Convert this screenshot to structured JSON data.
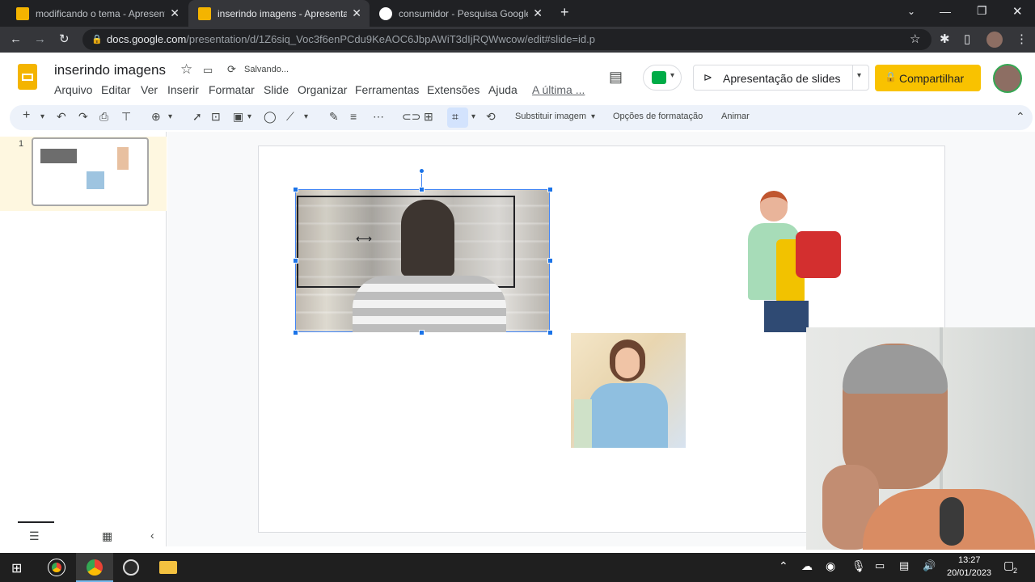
{
  "tabs": [
    {
      "title": "modificando o tema - Apresentação",
      "color": "#f4b400"
    },
    {
      "title": "inserindo imagens - Apresentação",
      "color": "#f4b400"
    },
    {
      "title": "consumidor - Pesquisa Google",
      "color": "#ffffff"
    }
  ],
  "address": {
    "host": "docs.google.com",
    "path": "/presentation/d/1Z6siq_Voc3f6enPCdu9KeAOC6JbpAWiT3dIjRQWwcow/edit#slide=id.p"
  },
  "doc": {
    "title": "inserindo imagens",
    "status": "Salvando..."
  },
  "menus": [
    "Arquivo",
    "Editar",
    "Ver",
    "Inserir",
    "Formatar",
    "Slide",
    "Organizar",
    "Ferramentas",
    "Extensões",
    "Ajuda",
    "A última ..."
  ],
  "header_buttons": {
    "present": "Apresentação de slides",
    "share": "Compartilhar"
  },
  "toolbar": {
    "replace": "Substituir imagem",
    "format": "Opções de formatação",
    "animate": "Animar"
  },
  "filmstrip": {
    "slide_number": "1"
  },
  "taskbar": {
    "time": "13:27",
    "date": "20/01/2023",
    "notif": "2"
  }
}
